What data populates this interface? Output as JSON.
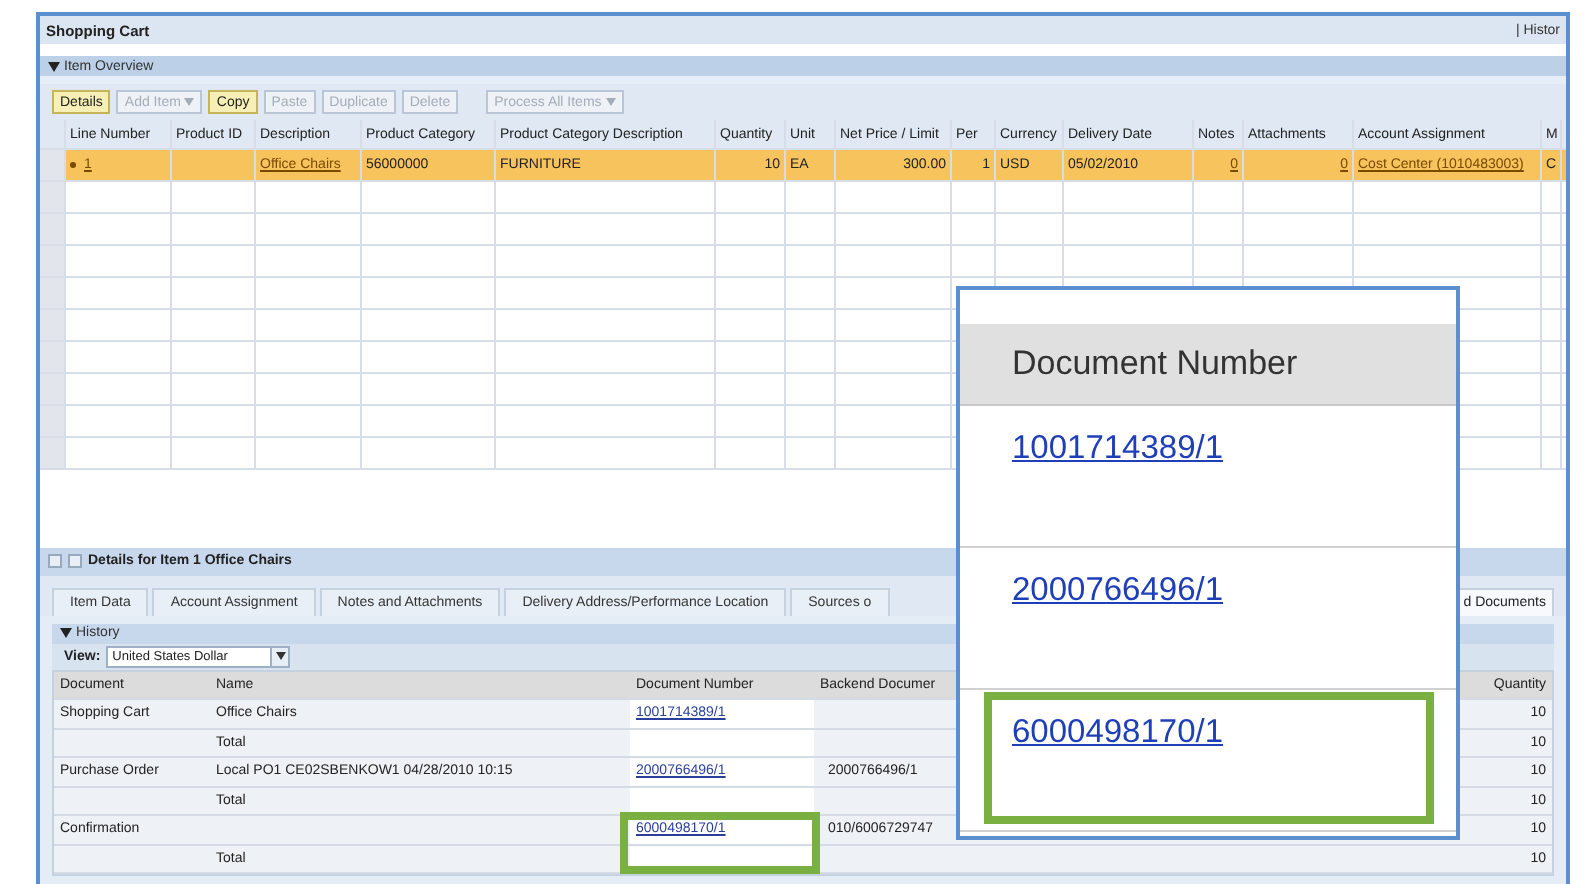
{
  "window": {
    "title": "Shopping Cart",
    "header_link": "| Histor"
  },
  "item_overview": {
    "title": "Item Overview",
    "toolbar": [
      {
        "label": "Details",
        "disabled": false,
        "dropdown": false
      },
      {
        "label": "Add Item",
        "disabled": true,
        "dropdown": true
      },
      {
        "label": "Copy",
        "disabled": false,
        "dropdown": false
      },
      {
        "label": "Paste",
        "disabled": true,
        "dropdown": false
      },
      {
        "label": "Duplicate",
        "disabled": true,
        "dropdown": false
      },
      {
        "label": "Delete",
        "disabled": true,
        "dropdown": false
      },
      {
        "label": "Process All Items",
        "disabled": true,
        "dropdown": true
      }
    ],
    "columns": [
      "Line Number",
      "Product ID",
      "Description",
      "Product Category",
      "Product Category Description",
      "Quantity",
      "Unit",
      "Net Price / Limit",
      "Per",
      "Currency",
      "Delivery Date",
      "Notes",
      "Attachments",
      "Account Assignment",
      "M"
    ],
    "rows": [
      {
        "selected": true,
        "cells": [
          {
            "text": "1",
            "kind": "link"
          },
          {
            "text": "",
            "kind": "text"
          },
          {
            "text": "Office Chairs",
            "kind": "link"
          },
          {
            "text": "56000000",
            "kind": "text"
          },
          {
            "text": "FURNITURE",
            "kind": "text"
          },
          {
            "text": "10",
            "kind": "number"
          },
          {
            "text": "EA",
            "kind": "text"
          },
          {
            "text": "300.00",
            "kind": "number"
          },
          {
            "text": "1",
            "kind": "number"
          },
          {
            "text": "USD",
            "kind": "text"
          },
          {
            "text": "05/02/2010",
            "kind": "text"
          },
          {
            "text": "0",
            "kind": "link"
          },
          {
            "text": "0",
            "kind": "link"
          },
          {
            "text": "Cost Center (1010483003)",
            "kind": "link"
          },
          {
            "text": "C",
            "kind": "text"
          }
        ]
      }
    ]
  },
  "details": {
    "title": "Details for Item 1 Office Chairs",
    "tabs": [
      {
        "label": "Item Data",
        "selected": false
      },
      {
        "label": "Account Assignment",
        "selected": false
      },
      {
        "label": "Notes and Attachments",
        "selected": false
      },
      {
        "label": "Delivery Address/Performance Location",
        "selected": false
      },
      {
        "label": "Sources o",
        "selected": false
      },
      {
        "label": "d Documents",
        "selected": true
      }
    ],
    "history": {
      "title": "History",
      "view_label": "View:",
      "view_value": "United States Dollar",
      "columns": [
        "Document",
        "Name",
        "Document Number",
        "Backend Documer",
        "Quantity"
      ],
      "rows": [
        {
          "document": "Shopping Cart",
          "name": "Office Chairs",
          "number": "1001714389/1",
          "backend": "",
          "quantity": "10",
          "highlighted": false
        },
        {
          "document": "",
          "name": "Total",
          "number": "",
          "backend": "",
          "quantity": "10",
          "highlighted": false
        },
        {
          "document": "Purchase Order",
          "name": "Local PO1 CE02SBENKOW1 04/28/2010 10:15",
          "number": "2000766496/1",
          "backend": "2000766496/1",
          "quantity": "10",
          "highlighted": false
        },
        {
          "document": "",
          "name": "Total",
          "number": "",
          "backend": "",
          "quantity": "10",
          "highlighted": false
        },
        {
          "document": "Confirmation",
          "name": "",
          "number": "6000498170/1",
          "backend": "010/6006729747",
          "quantity": "10",
          "highlighted": true
        },
        {
          "document": "",
          "name": "Total",
          "number": "",
          "backend": "",
          "quantity": "10",
          "highlighted": false
        }
      ]
    }
  },
  "callout": {
    "header": "Document Number",
    "links": [
      {
        "text": "1001714389/1",
        "highlighted": false
      },
      {
        "text": "2000766496/1",
        "highlighted": false
      },
      {
        "text": "6000498170/1",
        "highlighted": true
      }
    ]
  }
}
